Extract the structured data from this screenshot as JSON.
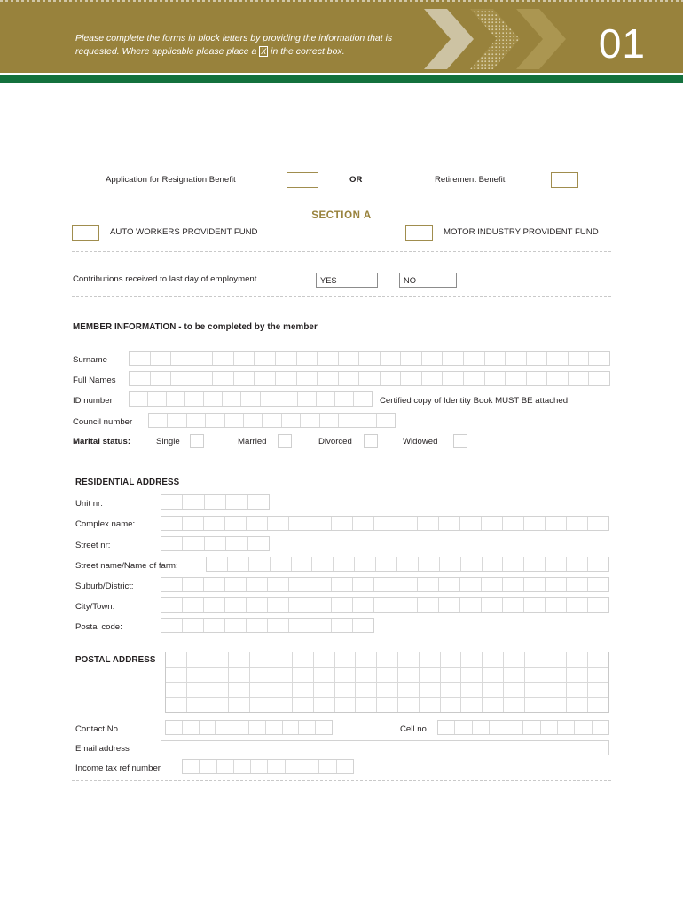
{
  "header": {
    "instruction_line1": "Please complete the forms in block letters by providing the information that is",
    "instruction_line2_pre": "requested. Where applicable please place a",
    "instruction_x": "X",
    "instruction_line2_post": "in the correct box.",
    "page_number": "01",
    "gold": "#98823c",
    "green": "#14713d"
  },
  "benefit": {
    "resignation_label": "Application for Resignation Benefit",
    "or_label": "OR",
    "retirement_label": "Retirement Benefit"
  },
  "section": {
    "title": "SECTION A",
    "fund_left": "AUTO WORKERS PROVIDENT FUND",
    "fund_right": "MOTOR INDUSTRY PROVIDENT FUND"
  },
  "contributions": {
    "label": "Contributions received to last day of employment",
    "yes": "YES",
    "no": "NO"
  },
  "member": {
    "heading": "MEMBER INFORMATION - to be completed by the member",
    "surname_label": "Surname",
    "surname_cells": 23,
    "fullnames_label": "Full Names",
    "fullnames_cells": 23,
    "id_label": "ID number",
    "id_cells": 13,
    "id_note": "Certified copy of Identity Book MUST BE attached",
    "council_label": "Council number",
    "council_cells": 13,
    "marital_label": "Marital status:",
    "marital_options": [
      "Single",
      "Married",
      "Divorced",
      "Widowed"
    ]
  },
  "residential": {
    "heading": "RESIDENTIAL ADDRESS",
    "rows": [
      {
        "label": "Unit nr:",
        "cells": 5
      },
      {
        "label": "Complex name:",
        "cells": 21
      },
      {
        "label": "Street nr:",
        "cells": 5
      },
      {
        "label": "Street name/Name of farm:",
        "cells": 19
      },
      {
        "label": "Suburb/District:",
        "cells": 21
      },
      {
        "label": "City/Town:",
        "cells": 21
      },
      {
        "label": "Postal code:",
        "cells": 10
      }
    ]
  },
  "postal": {
    "heading": "POSTAL ADDRESS",
    "grid_rows": 4,
    "grid_cols": 21
  },
  "contact": {
    "contact_label": "Contact No.",
    "contact_cells": 10,
    "cell_label": "Cell no.",
    "cell_cells": 10,
    "email_label": "Email address",
    "tax_label": "Income tax ref number",
    "tax_cells": 10
  }
}
